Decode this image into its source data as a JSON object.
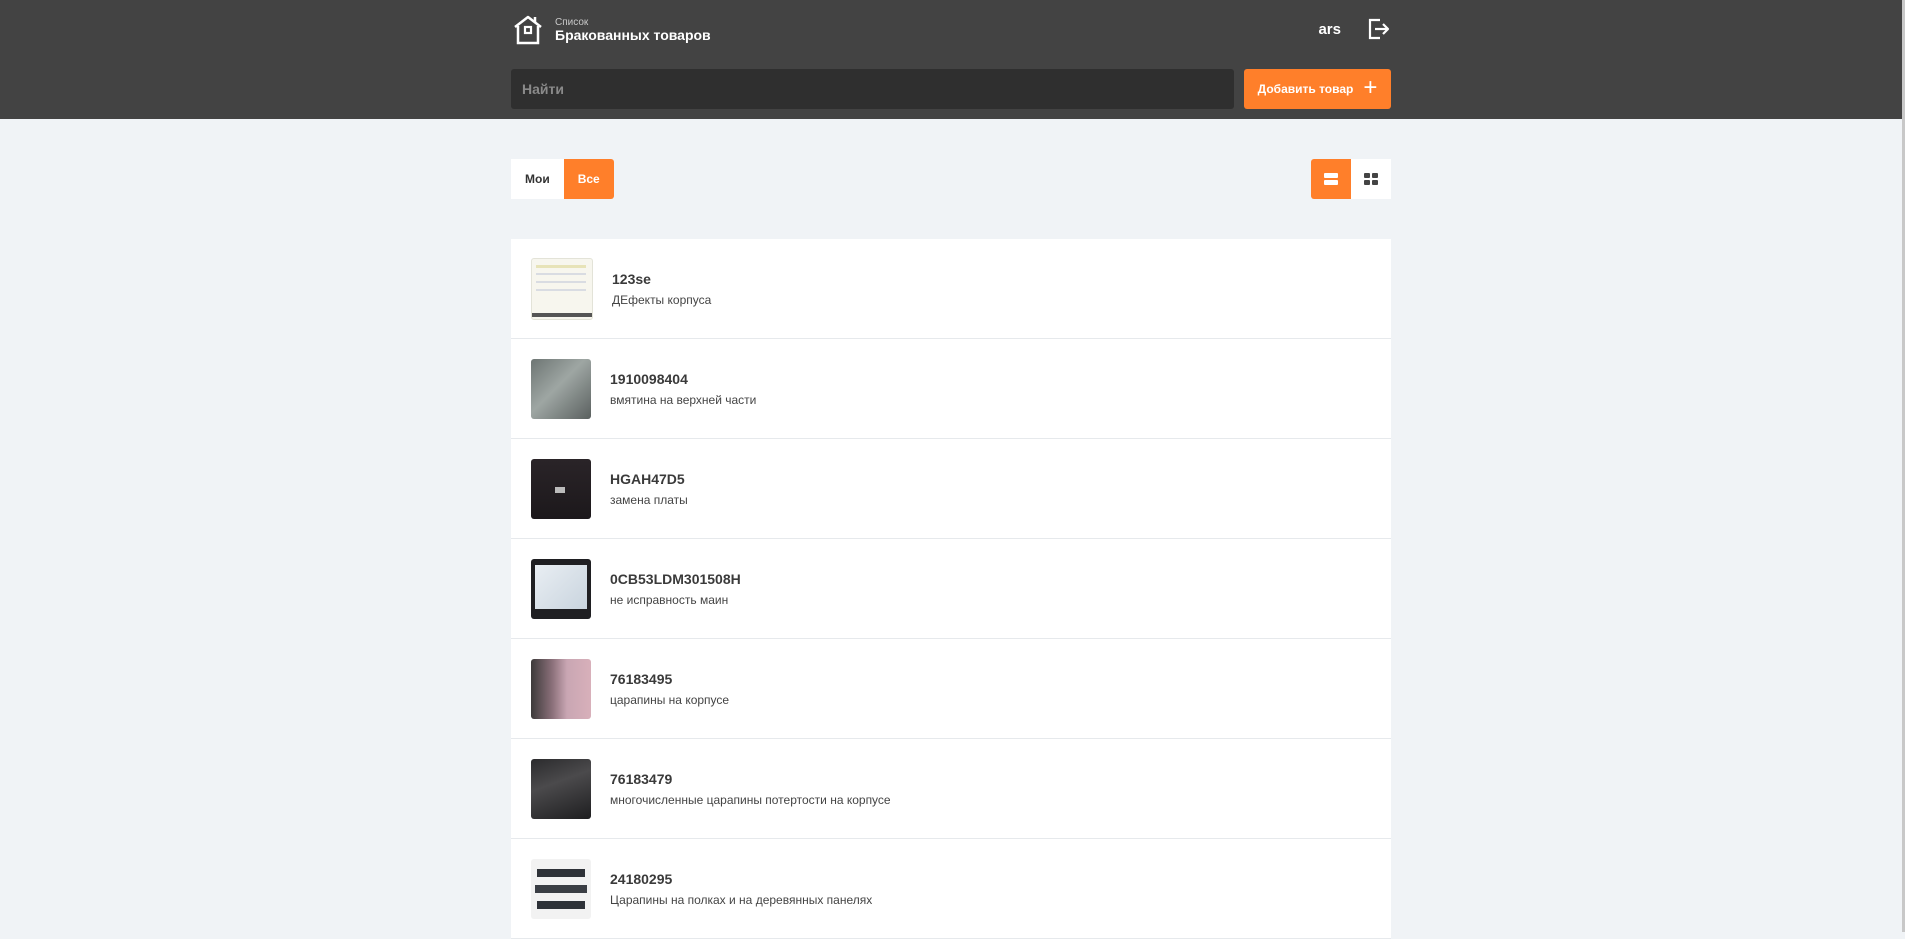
{
  "header": {
    "subtitle": "Список",
    "title": "Бракованных товаров",
    "username": "ars",
    "icons": {
      "brand": "home-icon",
      "logout": "logout-icon"
    }
  },
  "search": {
    "placeholder": "Найти",
    "value": ""
  },
  "add_button": {
    "label": "Добавить товар",
    "icon": "plus-icon"
  },
  "filters": [
    {
      "label": "Мои",
      "active": false
    },
    {
      "label": "Все",
      "active": true
    }
  ],
  "view_modes": [
    {
      "icon": "list-view-icon",
      "active": true
    },
    {
      "icon": "grid-view-icon",
      "active": false
    }
  ],
  "colors": {
    "accent": "#ff7f2a",
    "header_bg": "#434343",
    "page_bg": "#f0f3f6"
  },
  "items": [
    {
      "title": "123se",
      "description": "ДЕфекты корпуса",
      "thumb": "document-thumbnail"
    },
    {
      "title": "1910098404",
      "description": "вмятина на верхней части",
      "thumb": "photo-thumbnail"
    },
    {
      "title": "HGAH47D5",
      "description": "замена платы",
      "thumb": "photo-thumbnail"
    },
    {
      "title": "0CB53LDM301508H",
      "description": "не исправность маин",
      "thumb": "photo-thumbnail"
    },
    {
      "title": "76183495",
      "description": "царапины на корпусе",
      "thumb": "photo-thumbnail"
    },
    {
      "title": "76183479",
      "description": "многочисленные царапины потертости на корпусе",
      "thumb": "photo-thumbnail"
    },
    {
      "title": "24180295",
      "description": "Царапины на полках и на деревянных панелях",
      "thumb": "photo-thumbnail"
    }
  ]
}
